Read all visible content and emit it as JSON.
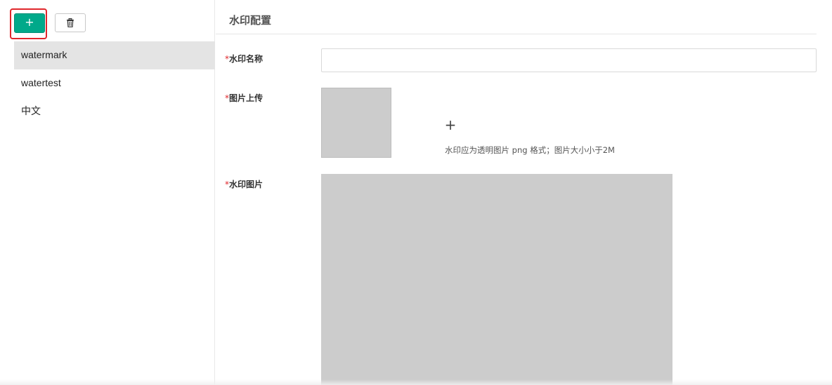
{
  "toolbar": {
    "add_label": "+"
  },
  "list": {
    "items": [
      {
        "label": "watermark",
        "active": true
      },
      {
        "label": "watertest",
        "active": false
      },
      {
        "label": "中文",
        "active": false
      }
    ]
  },
  "panel": {
    "title": "水印配置"
  },
  "form": {
    "required_mark": "*",
    "name_label": "水印名称",
    "name_value": "",
    "upload_label": "图片上传",
    "upload_plus": "+",
    "upload_hint": "水印应为透明图片 png 格式；图片大小小于2M",
    "image_label": "水印图片"
  },
  "colors": {
    "accent": "#00a98a",
    "highlight": "#e0262b",
    "placeholder_gray": "#cccccc",
    "active_row": "#e4e4e4"
  },
  "icons": {
    "delete": "trash-icon",
    "add": "plus-icon"
  }
}
